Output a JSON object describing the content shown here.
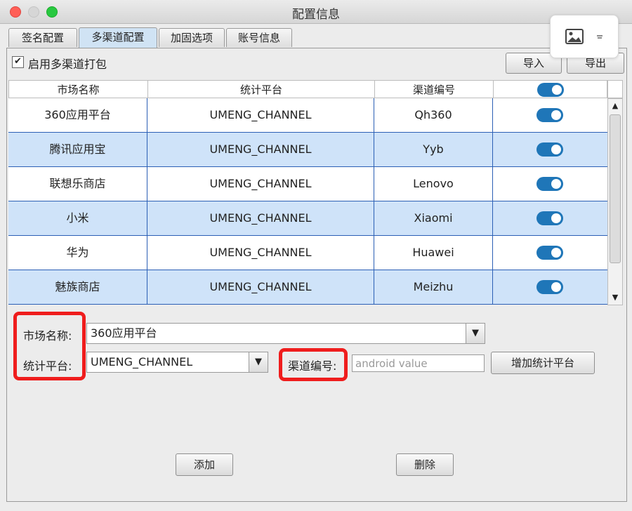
{
  "window": {
    "title": "配置信息"
  },
  "tabs": [
    {
      "label": "签名配置"
    },
    {
      "label": "多渠道配置"
    },
    {
      "label": "加固选项"
    },
    {
      "label": "账号信息"
    }
  ],
  "options": {
    "enable_multichannel_label": "启用多渠道打包",
    "enable_multichannel_checked": true
  },
  "toolbar": {
    "import_label": "导入",
    "export_label": "导出"
  },
  "table": {
    "columns": [
      "市场名称",
      "统计平台",
      "渠道编号",
      ""
    ],
    "rows": [
      {
        "market": "360应用平台",
        "platform": "UMENG_CHANNEL",
        "channel": "Qh360",
        "enabled": true
      },
      {
        "market": "腾讯应用宝",
        "platform": "UMENG_CHANNEL",
        "channel": "Yyb",
        "enabled": true
      },
      {
        "market": "联想乐商店",
        "platform": "UMENG_CHANNEL",
        "channel": "Lenovo",
        "enabled": true
      },
      {
        "market": "小米",
        "platform": "UMENG_CHANNEL",
        "channel": "Xiaomi",
        "enabled": true
      },
      {
        "market": "华为",
        "platform": "UMENG_CHANNEL",
        "channel": "Huawei",
        "enabled": true
      },
      {
        "market": "魅族商店",
        "platform": "UMENG_CHANNEL",
        "channel": "Meizhu",
        "enabled": true
      }
    ]
  },
  "form": {
    "market_label": "市场名称:",
    "market_value": "360应用平台",
    "platform_label": "统计平台:",
    "platform_value": "UMENG_CHANNEL",
    "channel_label": "渠道编号:",
    "channel_placeholder": "android value",
    "add_platform_label": "增加统计平台"
  },
  "actions": {
    "add_label": "添加",
    "delete_label": "删除"
  },
  "colors": {
    "accent": "#1f76b8",
    "row_alt": "#cfe3f9",
    "highlight": "#ef1d1d"
  }
}
